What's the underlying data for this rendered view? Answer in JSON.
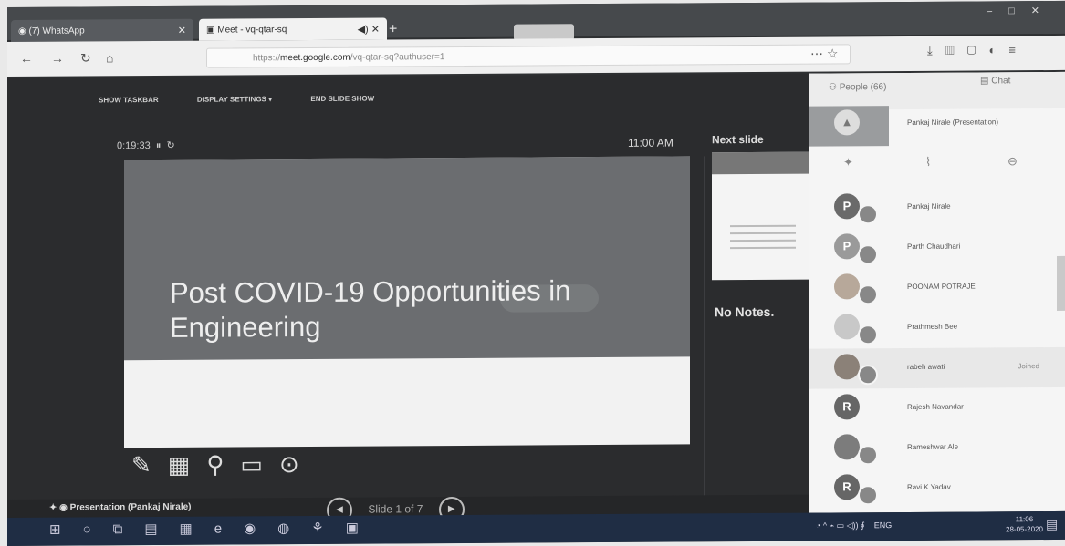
{
  "browser": {
    "tabs": [
      {
        "label": "(7) WhatsApp"
      },
      {
        "label": "Meet - vq-qtar-sq"
      }
    ],
    "address": {
      "host": "meet.google.com",
      "path": "/vq-qtar-sq?authuser=1",
      "prefix": "https://"
    }
  },
  "presentation": {
    "toolbar": {
      "show_taskbar": "SHOW TASKBAR",
      "display_settings": "DISPLAY SETTINGS ▾",
      "end_slide_show": "END SLIDE SHOW"
    },
    "timer": "0:19:33",
    "clock": "11:00 AM",
    "slide_title_line1": "Post COVID-19 Opportunities in",
    "slide_title_line2": "Engineering",
    "next_slide_label": "Next slide",
    "notes": "No Notes.",
    "presenter_label": "Presentation (Pankaj Nirale)",
    "slide_counter": "Slide 1 of 7"
  },
  "panel": {
    "people_tab": "People (66)",
    "chat_tab": "Chat",
    "presenter_row": "Pankaj Nirale (Presentation)",
    "people": [
      {
        "initial": "P",
        "name": "Pankaj Nirale",
        "status": ""
      },
      {
        "initial": "P",
        "name": "Parth Chaudhari",
        "status": ""
      },
      {
        "initial": "",
        "name": "POONAM POTRAJE",
        "status": ""
      },
      {
        "initial": "",
        "name": "Prathmesh Bee",
        "status": ""
      },
      {
        "initial": "",
        "name": "rabeh awati",
        "status": "Joined"
      },
      {
        "initial": "R",
        "name": "Rajesh Navandar",
        "status": ""
      },
      {
        "initial": "",
        "name": "Rameshwar Ale",
        "status": ""
      },
      {
        "initial": "R",
        "name": "Ravi K Yadav",
        "status": ""
      }
    ]
  },
  "taskbar": {
    "lang": "ENG",
    "time": "11:06",
    "date": "28-05-2020"
  }
}
